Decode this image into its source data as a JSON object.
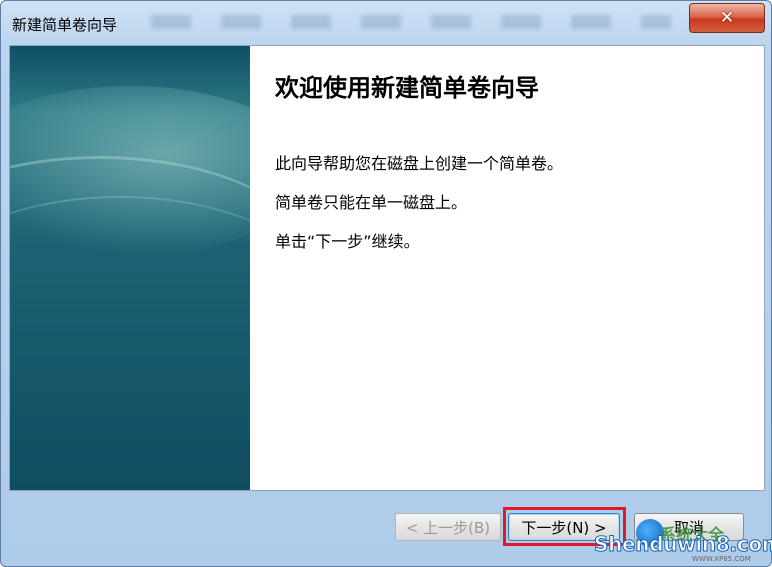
{
  "window": {
    "title": "新建简单卷向导",
    "close_glyph": "✕"
  },
  "main": {
    "heading": "欢迎使用新建简单卷向导",
    "lines": [
      "此向导帮助您在磁盘上创建一个简单卷。",
      "简单卷只能在单一磁盘上。",
      "单击“下一步”继续。"
    ]
  },
  "buttons": {
    "back_label": "< 上一步(B)",
    "next_label": "下一步(N) >",
    "cancel_label": "取消"
  },
  "watermark": {
    "brand": "Shenduwin8.com",
    "brand_cn": "系统大全",
    "domain": "WWW.XP85.COM"
  },
  "colors": {
    "highlight_border": "#e0192a",
    "side_panel": "#1d6274",
    "close_button": "#c43a1f"
  }
}
